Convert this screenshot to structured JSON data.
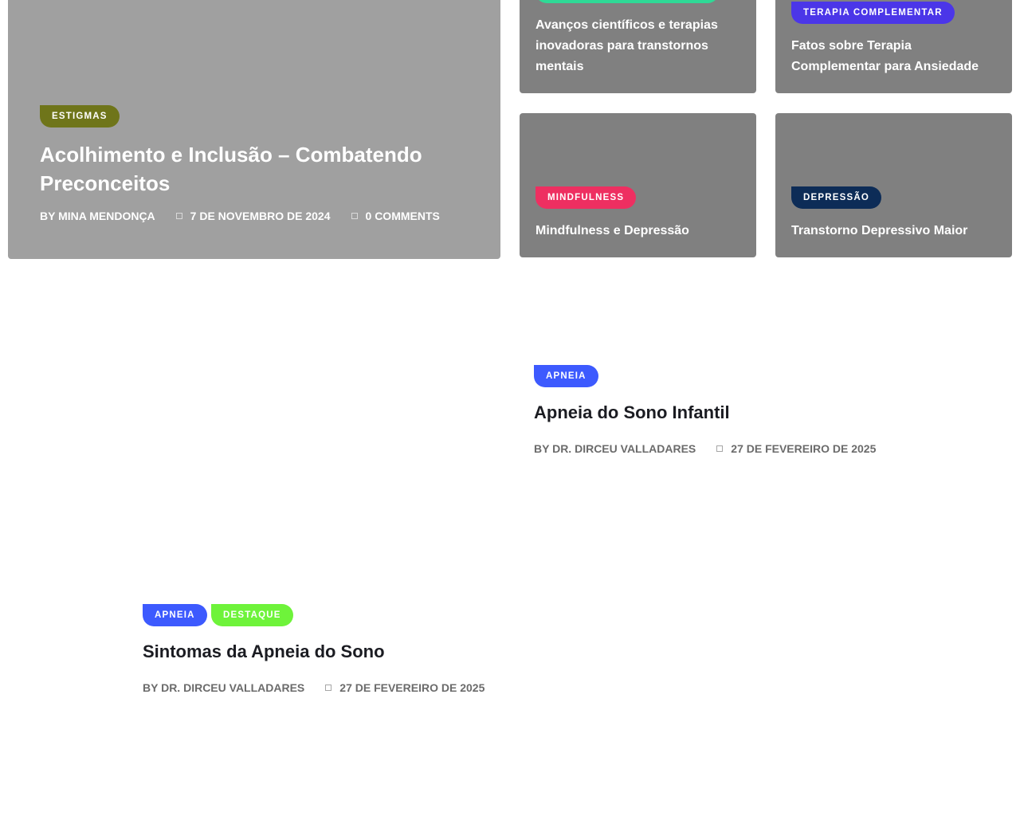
{
  "featured": {
    "badge": "ESTIGMAS",
    "badge_color": "#6f751a",
    "title": "Acolhimento e Inclusão – Combatendo Preconceitos",
    "author": "BY MINA MENDONÇA",
    "date": "7 DE NOVEMBRO DE 2024",
    "comments": "0 COMMENTS"
  },
  "grid": [
    {
      "badge_color": "#2fd996",
      "title": "Avanços científicos e terapias inovadoras para transtornos mentais"
    },
    {
      "badge": "TERAPIA COMPLEMENTAR",
      "badge_color": "#4b36e8",
      "title": "Fatos sobre Terapia Complementar para Ansiedade"
    },
    {
      "badge": "MINDFULNESS",
      "badge_color": "#ee2f61",
      "title": "Mindfulness e Depressão"
    },
    {
      "badge": "DEPRESSÃO",
      "badge_color": "#0d2c57",
      "title": "Transtorno Depressivo Maior"
    }
  ],
  "posts": [
    {
      "badges": [
        {
          "label": "APNEIA",
          "color": "#3d5afe"
        }
      ],
      "title": "Apneia do Sono Infantil",
      "author": "BY DR. DIRCEU VALLADARES",
      "date": "27 DE FEVEREIRO DE 2025"
    },
    {
      "badges": [
        {
          "label": "APNEIA",
          "color": "#3d5afe"
        },
        {
          "label": "DESTAQUE",
          "color": "#6ef33a"
        }
      ],
      "title": "Sintomas da Apneia do Sono",
      "author": "BY DR. DIRCEU VALLADARES",
      "date": "27 DE FEVEREIRO DE 2025"
    }
  ]
}
